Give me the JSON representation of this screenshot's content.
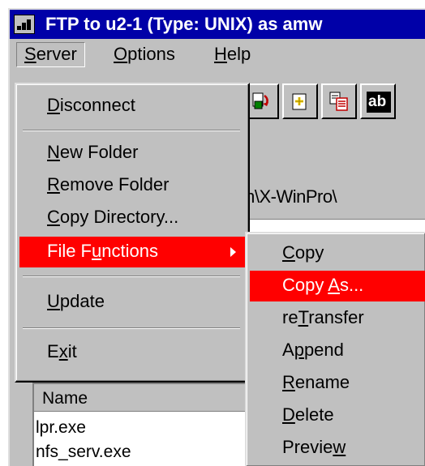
{
  "window": {
    "title": "FTP to u2-1 (Type: UNIX) as amw"
  },
  "menubar": {
    "server": {
      "label": "Server",
      "mnemonic": "S",
      "rest": "erver"
    },
    "options": {
      "label": "Options",
      "mnemonic": "O",
      "rest": "ptions"
    },
    "help": {
      "label": "Help",
      "mnemonic": "H",
      "rest": "elp"
    }
  },
  "toolbar": {
    "icons": [
      "transfer-icon",
      "new-file-icon",
      "copy-doc-icon",
      "rename-icon"
    ],
    "rename_text": "ab"
  },
  "path_text": "m\\X-WinPro\\",
  "server_menu": {
    "items": [
      {
        "pre": "",
        "u": "D",
        "post": "isconnect"
      },
      {
        "pre": "",
        "u": "N",
        "post": "ew Folder"
      },
      {
        "pre": "",
        "u": "R",
        "post": "emove Folder"
      },
      {
        "pre": "",
        "u": "C",
        "post": "opy Directory..."
      },
      {
        "pre": "File F",
        "u": "u",
        "post": "nctions"
      },
      {
        "pre": "",
        "u": "U",
        "post": "pdate"
      },
      {
        "pre": "E",
        "u": "x",
        "post": "it"
      }
    ]
  },
  "file_functions_menu": {
    "items": [
      {
        "pre": "",
        "u": "C",
        "post": "opy"
      },
      {
        "pre": "Copy ",
        "u": "A",
        "post": "s..."
      },
      {
        "pre": "re",
        "u": "T",
        "post": "ransfer"
      },
      {
        "pre": "A",
        "u": "p",
        "post": "pend"
      },
      {
        "pre": "",
        "u": "R",
        "post": "ename"
      },
      {
        "pre": "",
        "u": "D",
        "post": "elete"
      },
      {
        "pre": "Previe",
        "u": "w",
        "post": ""
      }
    ]
  },
  "file_list": {
    "column_header": "Name",
    "rows": [
      "lpr.exe",
      "nfs_serv.exe"
    ]
  },
  "colors": {
    "titlebar": "#0000a8",
    "highlight": "#ff0000",
    "face": "#c0c0c0"
  }
}
